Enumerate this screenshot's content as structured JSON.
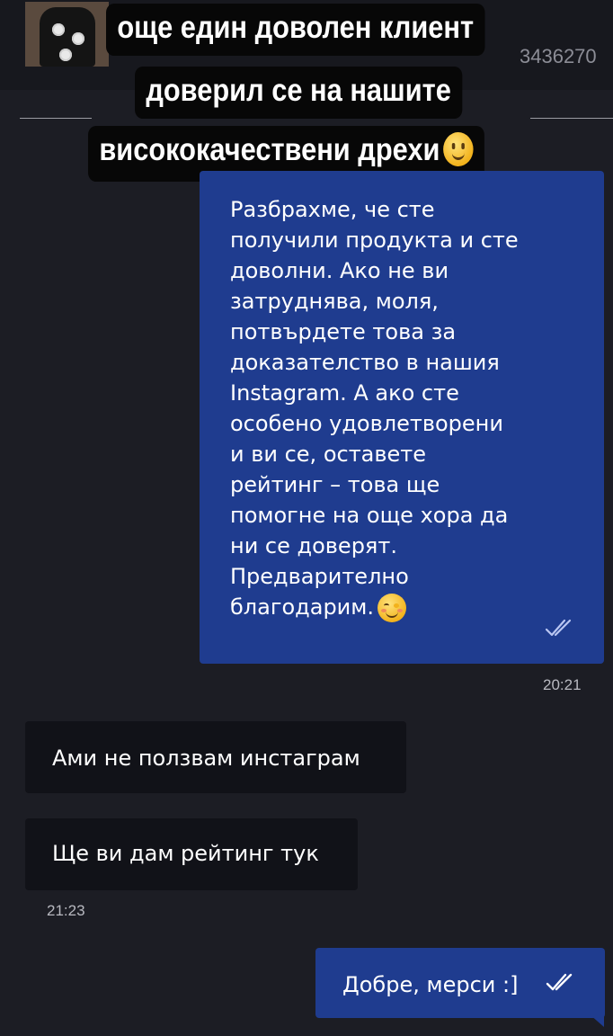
{
  "header": {
    "order_number_fragment": "3436270",
    "thumbnail_icon": "product-thumbnail-icon"
  },
  "overlay": {
    "lines": [
      "още един доволен клиент",
      "доверил се на нашите",
      "висококачествени дрехи"
    ],
    "emoji": "slightly-smiling-face-icon"
  },
  "messages": [
    {
      "direction": "outgoing",
      "lines": [
        "Разбрахме, че сте",
        "получили продукта и сте",
        "доволни. Ако не ви",
        "затруднява, моля,",
        "потвърдете това за",
        "доказателство в нашия",
        "Instagram. А ако сте",
        "особено удовлетворени",
        "и ви се, оставете",
        "рейтинг – това ще",
        "помогне на още хора да",
        "ни се доверят.",
        "Предварително",
        "благодарим."
      ],
      "emoji": "smiling-face-icon",
      "time": "20:21",
      "status": "read"
    },
    {
      "direction": "incoming",
      "text": "Ами не ползвам инстаграм"
    },
    {
      "direction": "incoming",
      "text": "Ще ви дам рейтинг тук",
      "time": "21:23"
    },
    {
      "direction": "outgoing",
      "text": "Добре, мерси :]",
      "status": "read"
    }
  ],
  "colors": {
    "background": "#1c1d24",
    "outgoing_bubble": "#1f3c8f",
    "incoming_bubble": "#111218",
    "read_ticks": "#b9c6f2",
    "overlay_bg": "#070707"
  }
}
